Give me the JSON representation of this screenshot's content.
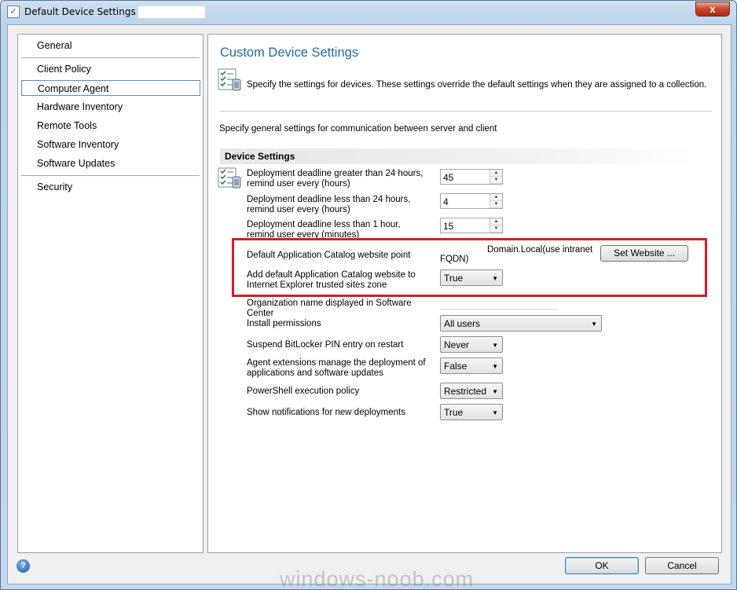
{
  "window": {
    "title": "Default Device Settings for",
    "close_label": "x"
  },
  "nav": {
    "items": [
      {
        "label": "General"
      },
      {
        "label": "Client Policy"
      },
      {
        "label": "Computer Agent",
        "selected": true
      },
      {
        "label": "Hardware Inventory"
      },
      {
        "label": "Remote Tools"
      },
      {
        "label": "Software Inventory"
      },
      {
        "label": "Software Updates"
      },
      {
        "label": "Security"
      }
    ]
  },
  "main": {
    "title": "Custom Device Settings",
    "description": "Specify the settings for devices. These settings override the default settings when they are assigned to a collection.",
    "general_description": "Specify general settings for communication between server and client",
    "section_title": "Device Settings",
    "settings": {
      "deadline_24h_greater": {
        "label": "Deployment deadline greater than 24 hours, remind user every (hours)",
        "value": "45"
      },
      "deadline_24h_less": {
        "label": "Deployment deadline less than 24 hours, remind user every (hours)",
        "value": "4"
      },
      "deadline_1h_less": {
        "label": "Deployment deadline less than 1 hour, remind user every (minutes)",
        "value": "15"
      },
      "catalog_point": {
        "label": "Default Application Catalog website point",
        "value_line1": "Domain.Local(use intranet",
        "value_line2": "FQDN)",
        "button": "Set Website ..."
      },
      "trusted_sites": {
        "label": "Add default Application Catalog website to Internet Explorer trusted sites zone",
        "value": "True"
      },
      "org_name": {
        "label": "Organization name displayed in Software Center",
        "value": ""
      },
      "install_permissions": {
        "label": "Install permissions",
        "value": "All users"
      },
      "bitlocker": {
        "label": "Suspend BitLocker PIN entry on restart",
        "value": "Never"
      },
      "agent_extensions": {
        "label": "Agent extensions manage the deployment of applications and software updates",
        "value": "False"
      },
      "powershell": {
        "label": "PowerShell execution policy",
        "value": "Restricted"
      },
      "notifications": {
        "label": "Show notifications for new deployments",
        "value": "True"
      }
    }
  },
  "footer": {
    "help_label": "?",
    "ok_label": "OK",
    "cancel_label": "Cancel"
  },
  "watermark": "windows-noob.com",
  "colors": {
    "title_blue": "#1e6aa8",
    "highlight_red": "#d21f28"
  }
}
